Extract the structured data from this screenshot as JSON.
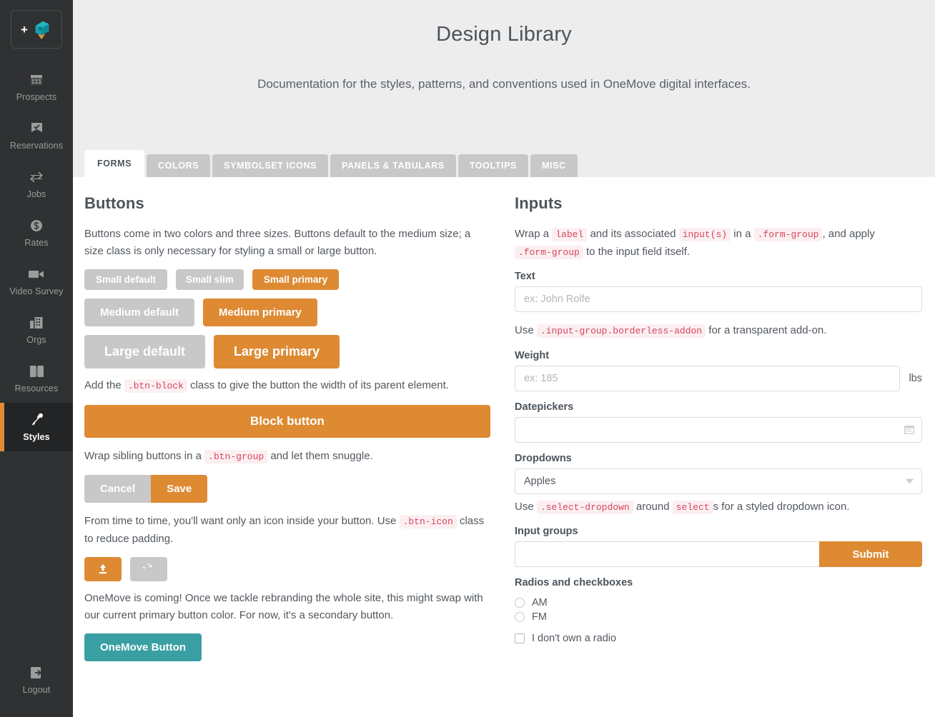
{
  "sidebar": {
    "logo": {
      "name": "onemove-logo",
      "plus": "+"
    },
    "items": [
      {
        "label": "Prospects",
        "icon": "grid-calendar-icon",
        "active": false
      },
      {
        "label": "Reservations",
        "icon": "checked-badge-icon",
        "active": false
      },
      {
        "label": "Jobs",
        "icon": "transfer-arrows-icon",
        "active": false
      },
      {
        "label": "Rates",
        "icon": "dollar-circle-icon",
        "active": false
      },
      {
        "label": "Video Survey",
        "icon": "video-camera-icon",
        "active": false
      },
      {
        "label": "Orgs",
        "icon": "buildings-icon",
        "active": false
      },
      {
        "label": "Resources",
        "icon": "open-book-icon",
        "active": false
      },
      {
        "label": "Styles",
        "icon": "eyedropper-icon",
        "active": true
      }
    ],
    "logout": {
      "label": "Logout",
      "icon": "logout-arrow-icon"
    }
  },
  "header": {
    "title": "Design Library",
    "subtitle": "Documentation for the styles, patterns, and conventions used in OneMove digital interfaces."
  },
  "tabs": [
    {
      "label": "FORMS",
      "active": true
    },
    {
      "label": "COLORS",
      "active": false
    },
    {
      "label": "SYMBOLSET ICONS",
      "active": false
    },
    {
      "label": "PANELS & TABULARS",
      "active": false
    },
    {
      "label": "TOOLTIPS",
      "active": false
    },
    {
      "label": "MISC",
      "active": false
    }
  ],
  "buttons_section": {
    "heading": "Buttons",
    "intro": "Buttons come in two colors and three sizes. Buttons default to the medium size; a size class is only necessary for styling a small or large button.",
    "small_default": "Small default",
    "small_slim": "Small slim",
    "small_primary": "Small primary",
    "medium_default": "Medium default",
    "medium_primary": "Medium primary",
    "large_default": "Large default",
    "large_primary": "Large primary",
    "block_text_1": "Add the",
    "block_code": ".btn-block",
    "block_text_2": "class to give the button the width of its parent element.",
    "block_button": "Block button",
    "group_text_1": "Wrap sibling buttons in a",
    "group_code": ".btn-group",
    "group_text_2": "and let them snuggle.",
    "cancel": "Cancel",
    "save": "Save",
    "icon_text_1": "From time to time, you'll want only an icon inside your button. Use",
    "icon_code": ".btn-icon",
    "icon_text_2": "class to reduce padding.",
    "upload_icon": "upload-icon",
    "refresh_icon": "refresh-icon",
    "onemove_text": "OneMove is coming! Once we tackle rebranding the whole site, this might swap with our current primary button color. For now, it's a secondary button.",
    "onemove_button": "OneMove Button"
  },
  "inputs_section": {
    "heading": "Inputs",
    "intro_1": "Wrap a",
    "intro_code_1": "label",
    "intro_2": "and its associated",
    "intro_code_2": "input(s)",
    "intro_3": "in a",
    "intro_code_3": ".form-group",
    "intro_4": ", and apply",
    "intro_code_4": ".form-group",
    "intro_5": "to the input field itself.",
    "text_label": "Text",
    "text_placeholder": "ex: John Rolfe",
    "text_value": "",
    "addon_text_1": "Use",
    "addon_code": ".input-group.borderless-addon",
    "addon_text_2": "for a transparent add-on.",
    "weight_label": "Weight",
    "weight_placeholder": "ex: 185",
    "weight_value": "",
    "weight_unit": "lbs",
    "datepicker_label": "Datepickers",
    "datepicker_value": "",
    "datepicker_icon": "calendar-icon",
    "dropdown_label": "Dropdowns",
    "dropdown_selected": "Apples",
    "dropdown_icon": "chevron-down-icon",
    "dropdown_text_1": "Use",
    "dropdown_code_1": ".select-dropdown",
    "dropdown_text_2": "around",
    "dropdown_code_2": "select",
    "dropdown_text_3": "s for a styled dropdown icon.",
    "inputgroup_label": "Input groups",
    "inputgroup_value": "",
    "submit_label": "Submit",
    "radios_label": "Radios and checkboxes",
    "radio_am": "AM",
    "radio_fm": "FM",
    "checkbox_label": "I don't own a radio"
  },
  "colors": {
    "primary": "#dd8a33",
    "default": "#c8c8c8",
    "onemove": "#3a9fa3",
    "sidebar": "#2f3132",
    "sidebar_active": "#232425",
    "header_bg": "#ededed",
    "code_text": "#d9455f",
    "code_bg": "#fbeff1",
    "body_text": "#52585f"
  }
}
